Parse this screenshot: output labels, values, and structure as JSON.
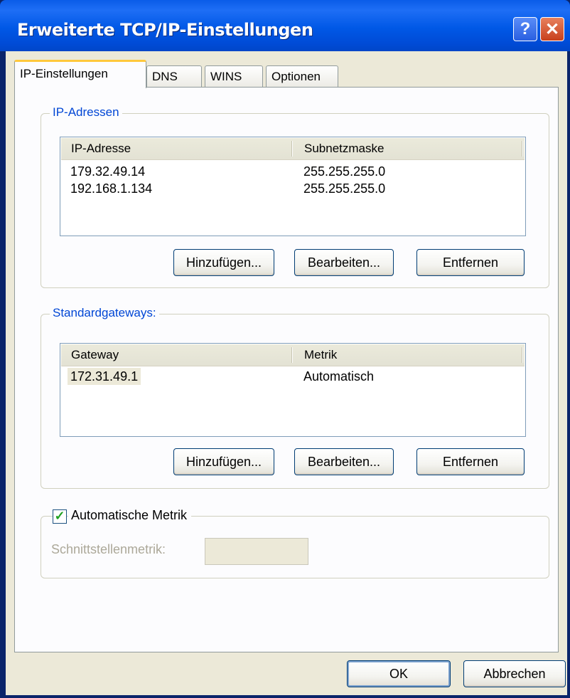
{
  "window": {
    "title": "Erweiterte TCP/IP-Einstellungen",
    "help_glyph": "?",
    "close_glyph": "✕"
  },
  "tabs": [
    {
      "label": "IP-Einstellungen",
      "active": true
    },
    {
      "label": "DNS",
      "active": false
    },
    {
      "label": "WINS",
      "active": false
    },
    {
      "label": "Optionen",
      "active": false
    }
  ],
  "ip_addresses": {
    "legend": "IP-Adressen",
    "columns": [
      "IP-Adresse",
      "Subnetzmaske"
    ],
    "rows": [
      [
        "179.32.49.14",
        "255.255.255.0"
      ],
      [
        "192.168.1.134",
        "255.255.255.0"
      ]
    ],
    "buttons": {
      "add": "Hinzufügen...",
      "edit": "Bearbeiten...",
      "remove": "Entfernen"
    }
  },
  "gateways": {
    "legend": "Standardgateways:",
    "columns": [
      "Gateway",
      "Metrik"
    ],
    "rows": [
      [
        "172.31.49.1",
        "Automatisch"
      ]
    ],
    "buttons": {
      "add": "Hinzufügen...",
      "edit": "Bearbeiten...",
      "remove": "Entfernen"
    }
  },
  "metric": {
    "auto_label": "Automatische Metrik",
    "auto_checked": true,
    "check_glyph": "✓",
    "interface_label": "Schnittstellenmetrik:",
    "interface_value": ""
  },
  "footer": {
    "ok": "OK",
    "cancel": "Abbrechen"
  }
}
